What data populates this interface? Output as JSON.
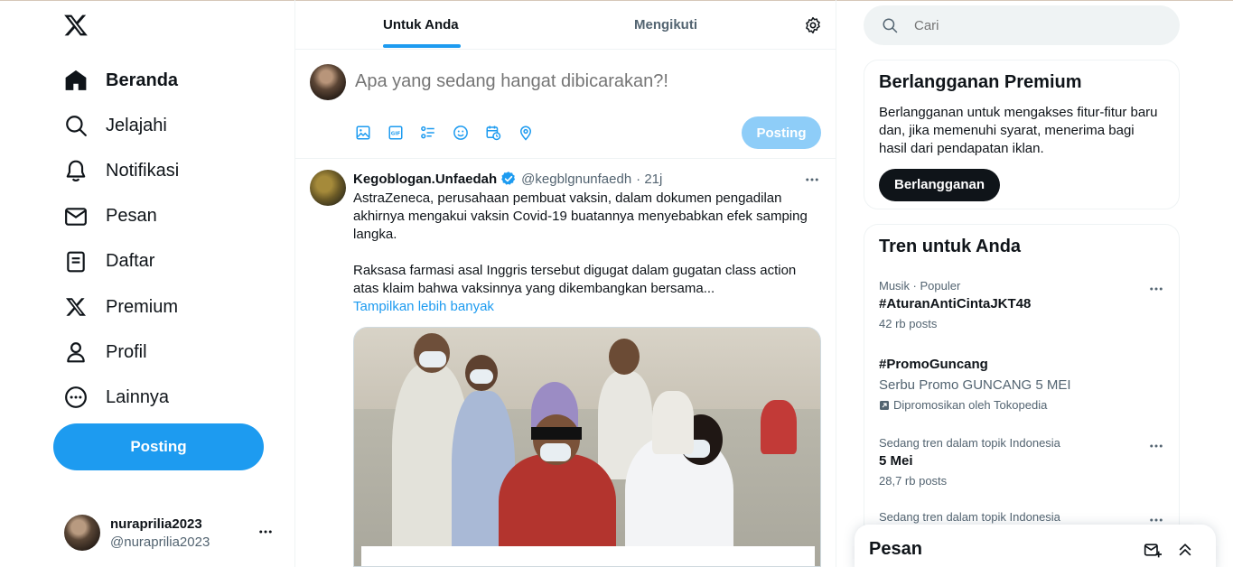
{
  "sidebar": {
    "logo": "x-logo-icon",
    "items": [
      {
        "label": "Beranda",
        "icon": "home-icon",
        "active": true
      },
      {
        "label": "Jelajahi",
        "icon": "search-icon"
      },
      {
        "label": "Notifikasi",
        "icon": "bell-icon"
      },
      {
        "label": "Pesan",
        "icon": "mail-icon"
      },
      {
        "label": "Daftar",
        "icon": "list-icon"
      },
      {
        "label": "Premium",
        "icon": "x-logo-icon"
      },
      {
        "label": "Profil",
        "icon": "person-icon"
      },
      {
        "label": "Lainnya",
        "icon": "more-circle-icon"
      }
    ],
    "post_label": "Posting",
    "account": {
      "name": "nuraprilia2023",
      "handle": "@nuraprilia2023"
    }
  },
  "timeline": {
    "tabs": [
      {
        "label": "Untuk Anda",
        "active": true
      },
      {
        "label": "Mengikuti"
      }
    ],
    "composer": {
      "placeholder": "Apa yang sedang hangat dibicarakan?!",
      "post_label": "Posting",
      "tools": [
        "image-icon",
        "gif-icon",
        "poll-icon",
        "emoji-icon",
        "schedule-icon",
        "location-icon"
      ]
    },
    "tweet": {
      "name": "Kegoblogan.Unfaedah",
      "handle": "@kegblgnunfaedh",
      "time": "· 21j",
      "verified": true,
      "text1": "AstraZeneca, perusahaan pembuat vaksin,  dalam dokumen pengadilan akhirnya mengakui vaksin Covid-19 buatannya menyebabkan efek samping langka.",
      "text2": "Raksasa farmasi asal Inggris tersebut digugat dalam gugatan class action atas klaim bahwa vaksinnya yang dikembangkan bersama...",
      "show_more": "Tampilkan lebih banyak"
    }
  },
  "right": {
    "search": {
      "placeholder": "Cari"
    },
    "premium": {
      "title": "Berlangganan Premium",
      "text": "Berlangganan untuk mengakses fitur-fitur baru dan, jika memenuhi syarat, menerima bagi hasil dari pendapatan iklan.",
      "button": "Berlangganan"
    },
    "trends": {
      "title": "Tren untuk Anda",
      "items": [
        {
          "meta": "Musik · Populer",
          "name": "#AturanAntiCintaJKT48",
          "count": "42 rb posts"
        },
        {
          "name": "#PromoGuncang",
          "desc": "Serbu Promo GUNCANG 5 MEI",
          "promo": "Dipromosikan oleh Tokopedia"
        },
        {
          "meta": "Sedang tren dalam topik Indonesia",
          "name": "5 Mei",
          "count": "28,7 rb posts"
        },
        {
          "meta": "Sedang tren dalam topik Indonesia"
        }
      ]
    },
    "messages": {
      "title": "Pesan"
    }
  },
  "colors": {
    "accent": "#1d9bf0",
    "text": "#0f1419",
    "muted": "#536471",
    "border": "#eff3f4",
    "disabled_accent": "#8ecdf8"
  }
}
